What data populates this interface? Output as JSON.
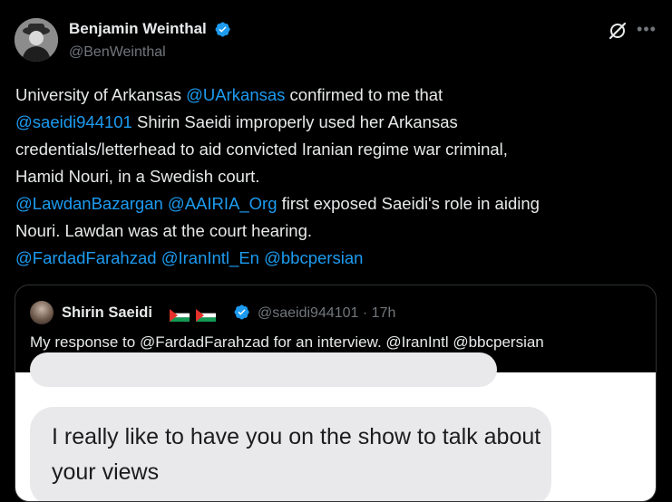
{
  "author": {
    "name": "Benjamin Weinthal",
    "handle": "@BenWeinthal",
    "verified": true
  },
  "icons": {
    "grok": "grok-icon",
    "more": "more-icon",
    "verified": "verified-badge-icon"
  },
  "colors": {
    "background": "#000000",
    "text": "#e7e9ea",
    "secondary": "#71767b",
    "link": "#1d9bf0",
    "verified": "#1d9bf0"
  },
  "tweet": {
    "line1_a": "University of Arkansas ",
    "line1_link": "@UArkansas",
    "line1_b": " confirmed to me that",
    "line2_link": "@saeidi944101",
    "line2_b": " Shirin Saeidi improperly used her Arkansas",
    "line3": "credentials/letterhead to aid convicted Iranian regime war criminal,",
    "line4": "Hamid Nouri, in a Swedish court.",
    "line5_link1": "@LawdanBazargan",
    "line5_link2": "@AAIRIA_Org",
    "line5_b": " first exposed Saeidi's role in aiding",
    "line6": "Nouri. Lawdan was at the court hearing.",
    "line7_link1": "@FardadFarahzad",
    "line7_link2": "@IranIntl_En",
    "line7_link3": "@bbcpersian"
  },
  "quote": {
    "name": "Shirin Saeidi",
    "flags": [
      "palestine-flag",
      "palestine-flag"
    ],
    "verified": true,
    "handle": "@saeidi944101",
    "separator": "·",
    "time": "17h",
    "text": "My response to @FardadFarahzad for an interview. @IranIntl @bbcpersian",
    "image": {
      "message_text": "I really like to have you on the show to talk about your views"
    }
  }
}
